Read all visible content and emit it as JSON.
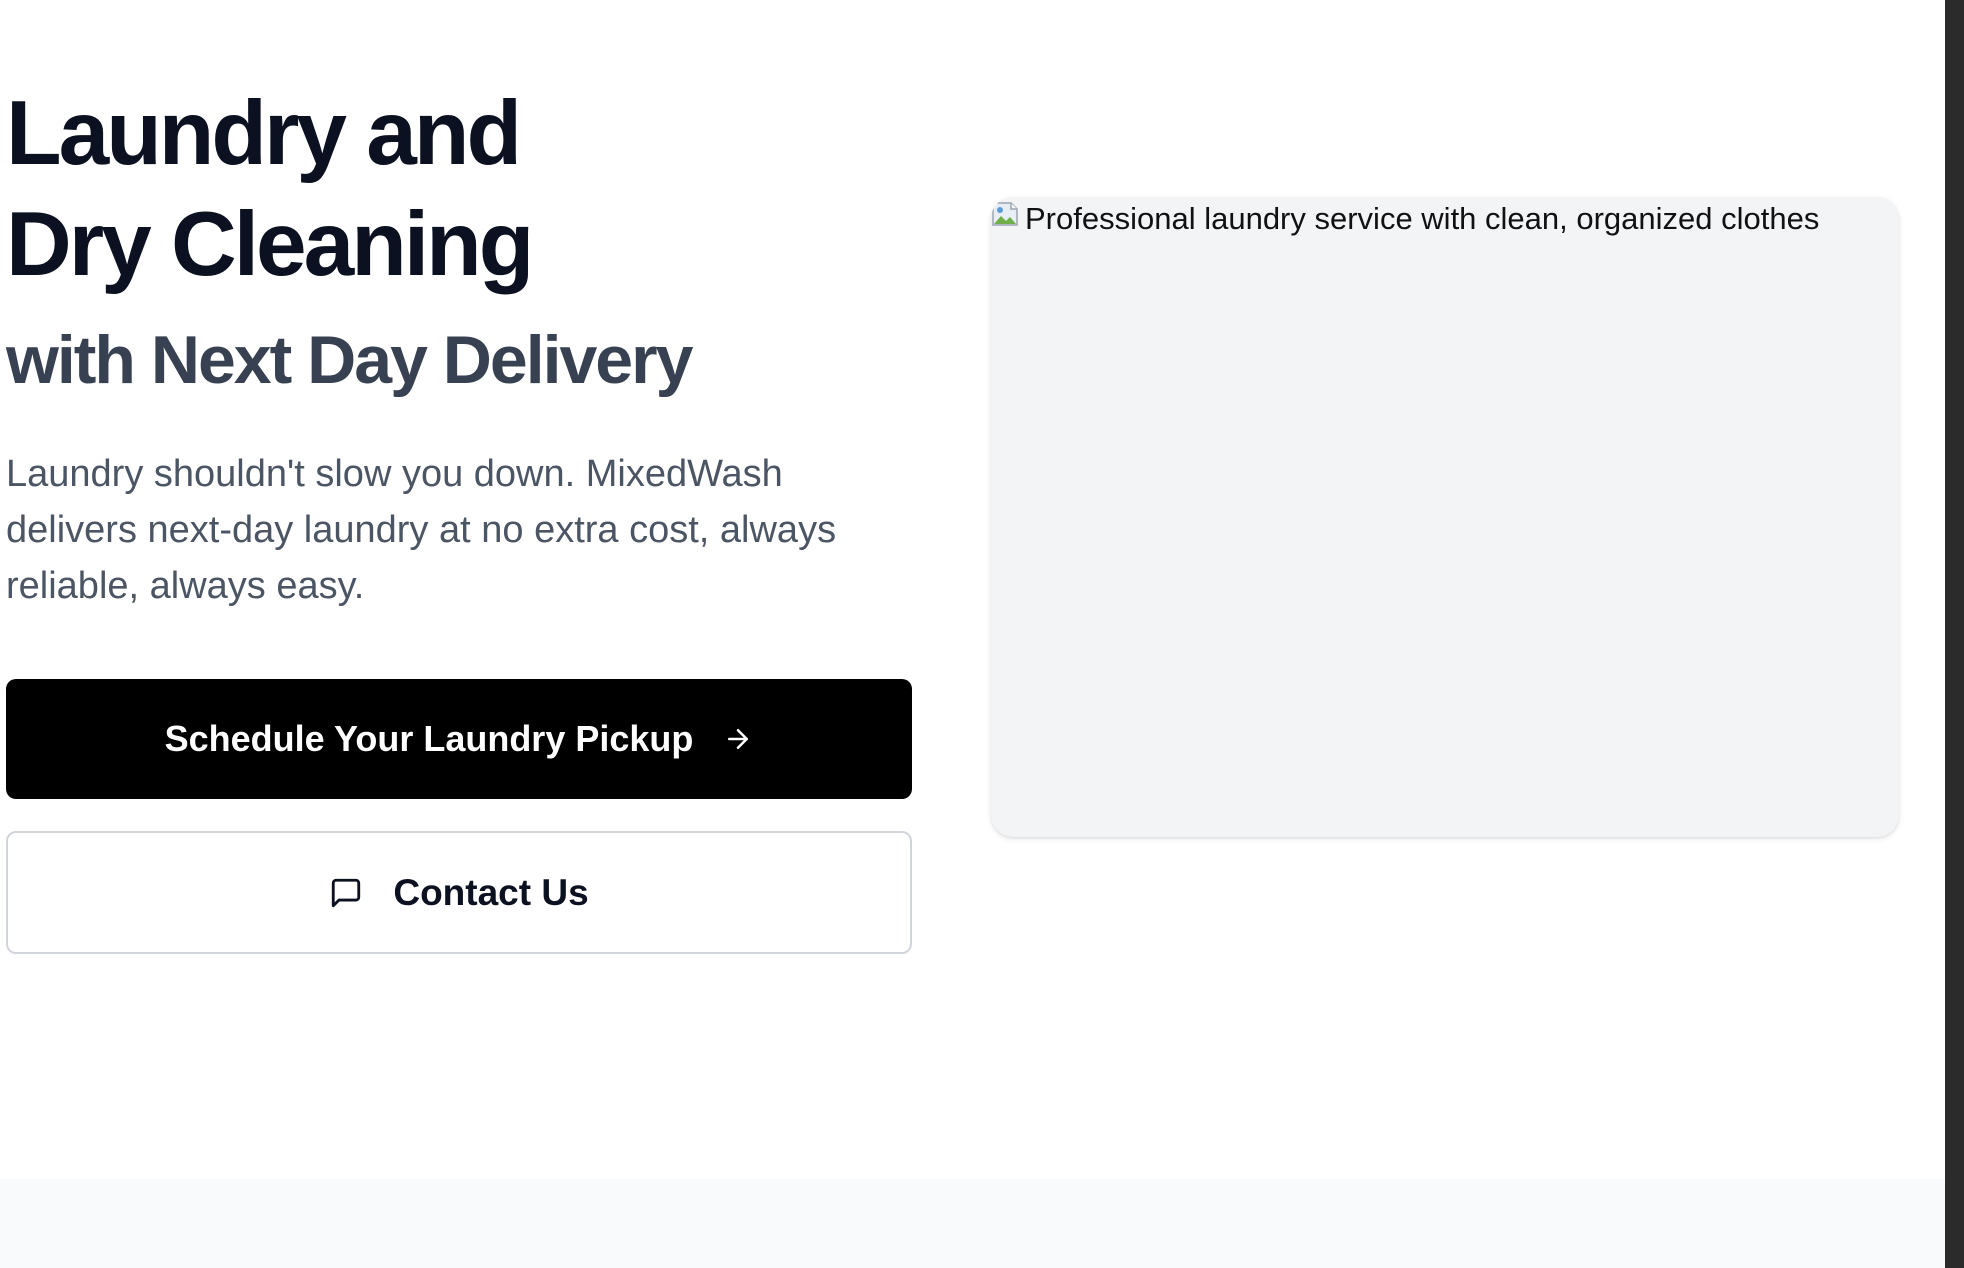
{
  "hero": {
    "title_line1": "Laundry and",
    "title_line2": "Dry Cleaning",
    "subtitle": "with Next Day Delivery",
    "description": "Laundry shouldn't slow you down. MixedWash delivers next-day laundry at no extra cost, always reliable, always easy."
  },
  "actions": {
    "primary_label": "Schedule Your Laundry Pickup",
    "primary_icon": "arrow-right-icon",
    "secondary_label": "Contact Us",
    "secondary_icon": "message-square-icon"
  },
  "hero_image": {
    "alt_text": "Professional laundry service with clean, organized clothes",
    "icon": "broken-image-icon"
  },
  "colors": {
    "heading": "#0b1120",
    "subheading": "#374151",
    "body_text": "#4b5563",
    "primary_button_bg": "#000000",
    "primary_button_text": "#ffffff",
    "secondary_button_border": "#d1d5db",
    "image_placeholder_bg": "#f3f4f6",
    "next_section_bg": "#f9fafb"
  }
}
